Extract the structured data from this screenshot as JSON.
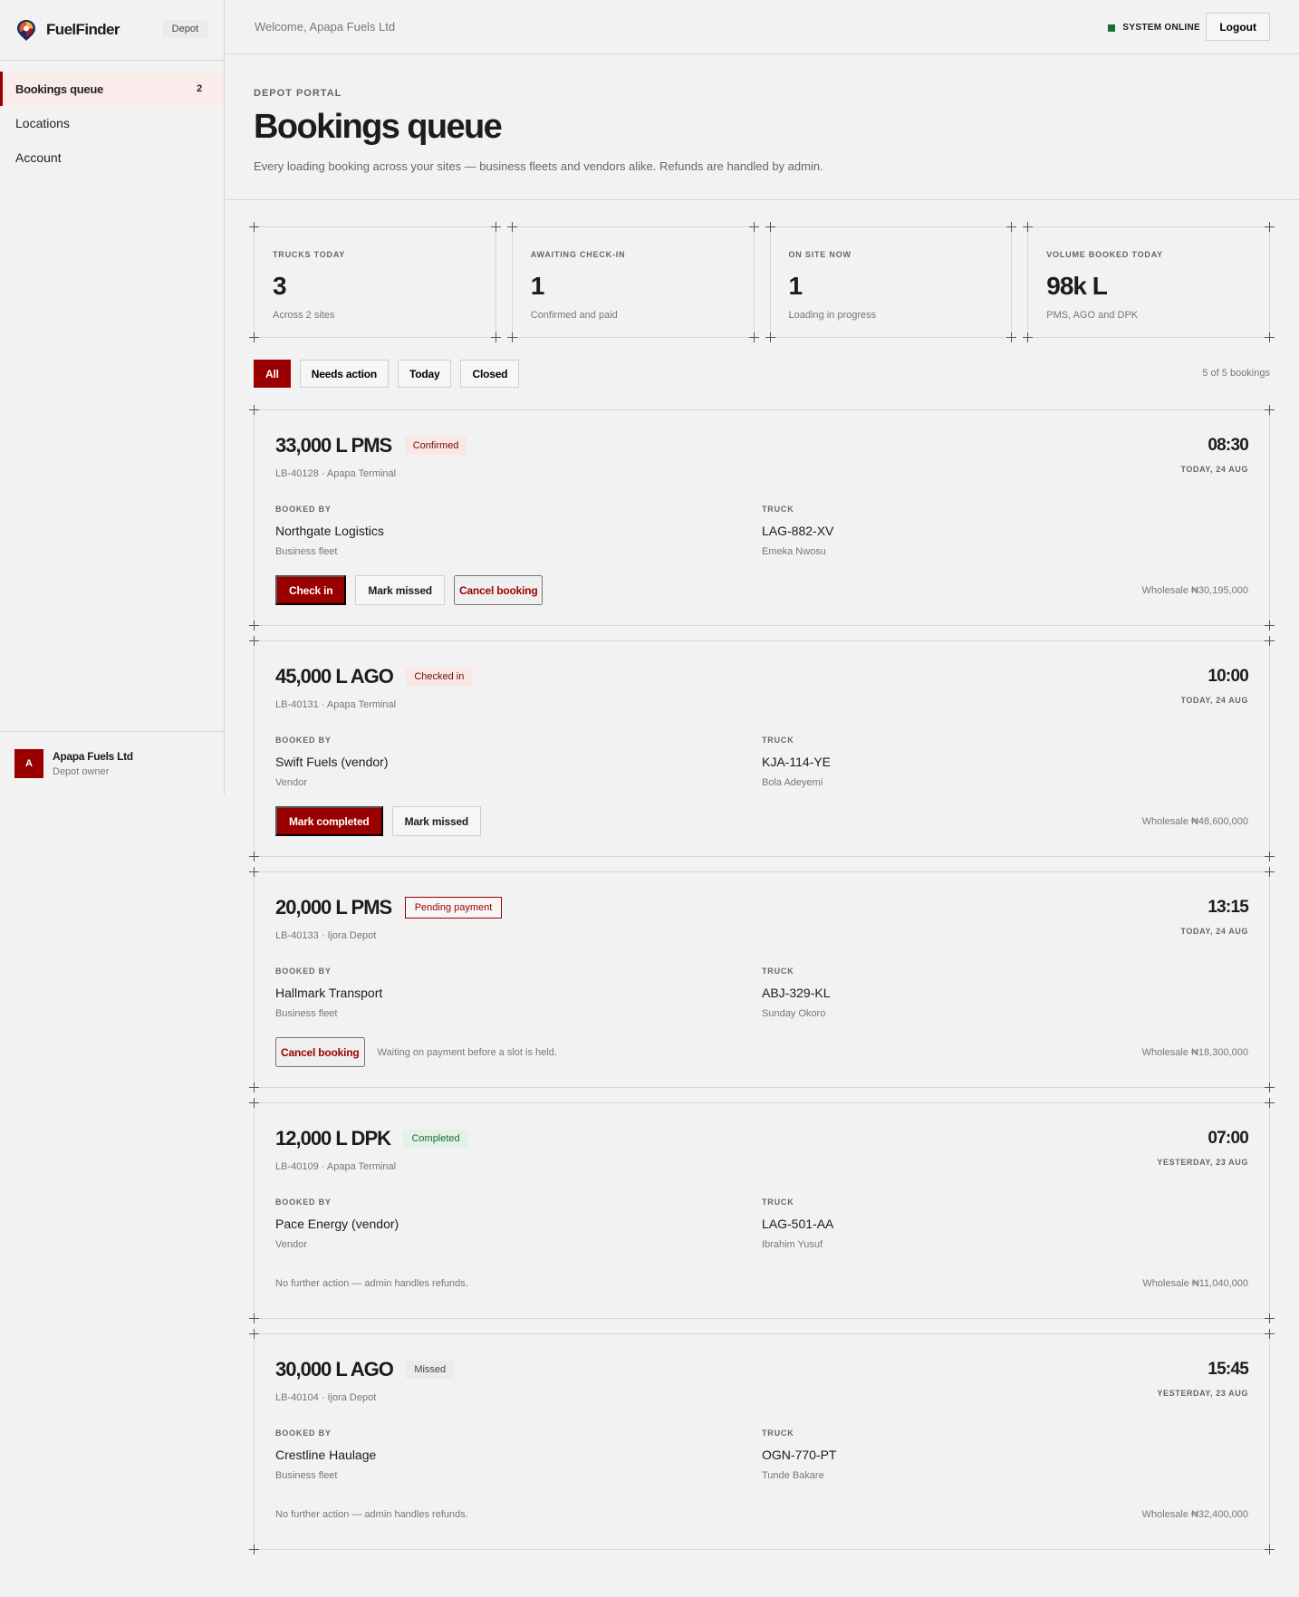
{
  "brand": {
    "name": "FuelFinder",
    "tag": "Depot"
  },
  "sidebar": {
    "items": [
      {
        "label": "Bookings queue",
        "badge": "2",
        "active": true
      },
      {
        "label": "Locations",
        "badge": "",
        "active": false
      },
      {
        "label": "Account",
        "badge": "",
        "active": false
      }
    ],
    "user": {
      "initial": "A",
      "name": "Apapa Fuels Ltd",
      "role": "Depot owner"
    }
  },
  "topbar": {
    "welcome": "Welcome, Apapa Fuels Ltd",
    "status": "SYSTEM ONLINE",
    "logout": "Logout"
  },
  "header": {
    "eyebrow": "DEPOT PORTAL",
    "title": "Bookings queue",
    "subtitle": "Every loading booking across your sites — business fleets and vendors alike. Refunds are handled by admin."
  },
  "stats": [
    {
      "label": "TRUCKS TODAY",
      "value": "3",
      "note": "Across 2 sites"
    },
    {
      "label": "AWAITING CHECK-IN",
      "value": "1",
      "note": "Confirmed and paid"
    },
    {
      "label": "ON SITE NOW",
      "value": "1",
      "note": "Loading in progress"
    },
    {
      "label": "VOLUME BOOKED TODAY",
      "value": "98k L",
      "note": "PMS, AGO and DPK"
    }
  ],
  "filters": [
    "All",
    "Needs action",
    "Today",
    "Closed"
  ],
  "count": "5 of 5 bookings",
  "labels": {
    "booked_by": "BOOKED BY",
    "truck": "TRUCK"
  },
  "bookings": [
    {
      "volume": "33,000 L PMS",
      "status": "Confirmed",
      "ref": "LB-40128 · Apapa Terminal",
      "time": "08:30",
      "day": "TODAY, 24 AUG",
      "booked_by": "Northgate Logistics",
      "booked_type": "Business fleet",
      "truck": "LAG-882-XV",
      "driver": "Emeka Nwosu",
      "actions": [
        "Check in",
        "Mark missed",
        "Cancel booking"
      ],
      "note": "",
      "wholesale": "Wholesale ₦30,195,000"
    },
    {
      "volume": "45,000 L AGO",
      "status": "Checked in",
      "ref": "LB-40131 · Apapa Terminal",
      "time": "10:00",
      "day": "TODAY, 24 AUG",
      "booked_by": "Swift Fuels (vendor)",
      "booked_type": "Vendor",
      "truck": "KJA-114-YE",
      "driver": "Bola Adeyemi",
      "actions": [
        "Mark completed",
        "Mark missed"
      ],
      "note": "",
      "wholesale": "Wholesale ₦48,600,000"
    },
    {
      "volume": "20,000 L PMS",
      "status": "Pending payment",
      "ref": "LB-40133 · Ijora Depot",
      "time": "13:15",
      "day": "TODAY, 24 AUG",
      "booked_by": "Hallmark Transport",
      "booked_type": "Business fleet",
      "truck": "ABJ-329-KL",
      "driver": "Sunday Okoro",
      "actions": [
        "Cancel booking"
      ],
      "note": "Waiting on payment before a slot is held.",
      "wholesale": "Wholesale ₦18,300,000"
    },
    {
      "volume": "12,000 L DPK",
      "status": "Completed",
      "ref": "LB-40109 · Apapa Terminal",
      "time": "07:00",
      "day": "YESTERDAY, 23 AUG",
      "booked_by": "Pace Energy (vendor)",
      "booked_type": "Vendor",
      "truck": "LAG-501-AA",
      "driver": "Ibrahim Yusuf",
      "actions": [],
      "note": "No further action — admin handles refunds.",
      "wholesale": "Wholesale ₦11,040,000"
    },
    {
      "volume": "30,000 L AGO",
      "status": "Missed",
      "ref": "LB-40104 · Ijora Depot",
      "time": "15:45",
      "day": "YESTERDAY, 23 AUG",
      "booked_by": "Crestline Haulage",
      "booked_type": "Business fleet",
      "truck": "OGN-770-PT",
      "driver": "Tunde Bakare",
      "actions": [],
      "note": "No further action — admin handles refunds.",
      "wholesale": "Wholesale ₦32,400,000"
    }
  ],
  "colors": {
    "accent": "#9b0000",
    "online": "#1e6b3a",
    "background": "#f2f2f2"
  }
}
